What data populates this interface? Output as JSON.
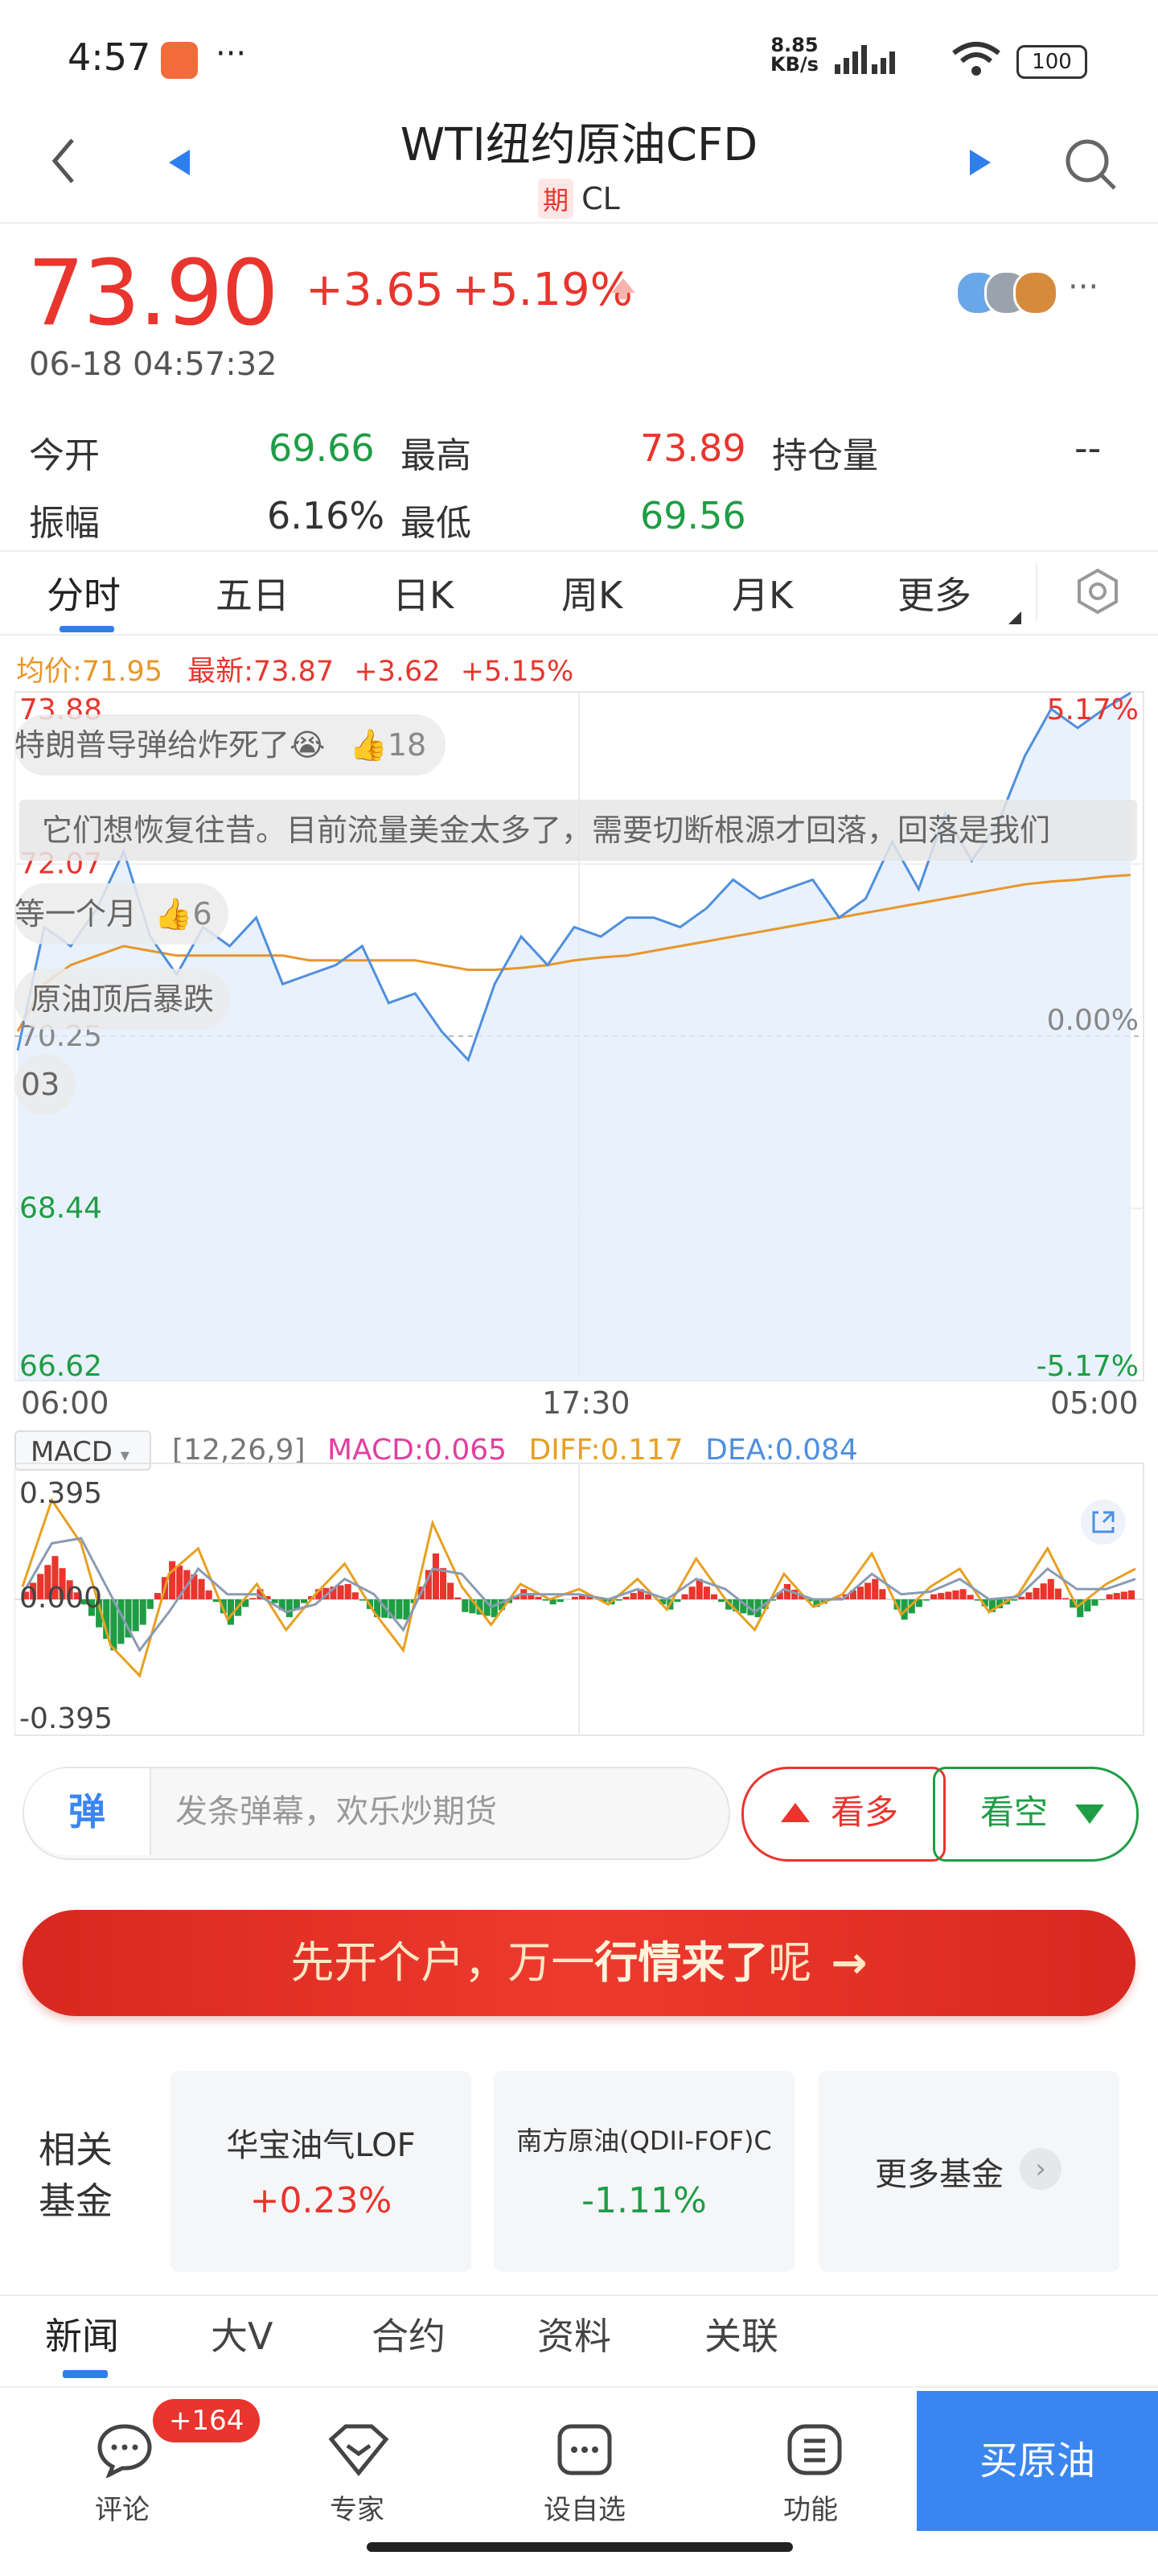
{
  "status_bar": {
    "time": "4:57",
    "dots": "···",
    "net_speed_line1": "8.85",
    "net_speed_line2": "KB/s",
    "battery": "100"
  },
  "header": {
    "title": "WTI纽约原油CFD",
    "tag": "期",
    "symbol": "CL"
  },
  "quote": {
    "price": "73.90",
    "change": "+3.65",
    "change_pct": "+5.19%",
    "datetime": "06-18 04:57:32",
    "more_dots": "···"
  },
  "stats": {
    "open_label": "今开",
    "open_value": "69.66",
    "high_label": "最高",
    "high_value": "73.89",
    "oi_label": "持仓量",
    "oi_value": "--",
    "amp_label": "振幅",
    "amp_value": "6.16%",
    "low_label": "最低",
    "low_value": "69.56"
  },
  "tabs": [
    "分时",
    "五日",
    "日K",
    "周K",
    "月K",
    "更多"
  ],
  "intraday": {
    "avg_label": "均价:71.95",
    "latest_label": "最新:73.87",
    "latest_change": "+3.62",
    "latest_pct": "+5.15%",
    "y_left": [
      "73.88",
      "72.07",
      "70.25",
      "68.44",
      "66.62"
    ],
    "y_right": [
      "5.17%",
      "0.00%",
      "-5.17%"
    ],
    "x_labels": [
      "06:00",
      "17:30",
      "05:00"
    ]
  },
  "danmaku": [
    {
      "text": "特朗普导弹给炸死了😭",
      "likes": "18"
    },
    {
      "text": "它们想恢复往昔。目前流量美金太多了，需要切断根源才回落，回落是我们"
    },
    {
      "text": "等一个月",
      "likes": "6"
    },
    {
      "text": "原油顶后暴跌"
    },
    {
      "text": "03"
    }
  ],
  "macd": {
    "selector": "MACD",
    "params": "[12,26,9]",
    "macd": "MACD:0.065",
    "diff": "DIFF:0.117",
    "dea": "DEA:0.084",
    "y_labels": [
      "0.395",
      "0.000",
      "-0.395"
    ]
  },
  "chart_data": {
    "type": "line",
    "title": "",
    "x_labels": [
      "06:00",
      "17:30",
      "05:00"
    ],
    "ylim": [
      66.62,
      73.88
    ],
    "prev_close": 70.25,
    "series": [
      {
        "name": "最新",
        "values": [
          70.1,
          71.4,
          71.2,
          71.6,
          72.2,
          71.3,
          70.9,
          71.4,
          71.2,
          71.5,
          70.8,
          70.9,
          71.0,
          71.2,
          70.6,
          70.7,
          70.3,
          70.0,
          70.8,
          71.3,
          71.0,
          71.4,
          71.3,
          71.5,
          71.5,
          71.4,
          71.6,
          71.9,
          71.7,
          71.8,
          71.9,
          71.5,
          71.7,
          72.3,
          71.8,
          72.6,
          72.1,
          72.5,
          73.2,
          73.7,
          73.5,
          73.7,
          73.87
        ]
      },
      {
        "name": "均价",
        "values": [
          70.3,
          70.8,
          71.0,
          71.1,
          71.2,
          71.15,
          71.1,
          71.1,
          71.1,
          71.1,
          71.1,
          71.05,
          71.05,
          71.05,
          71.05,
          71.05,
          71.0,
          70.95,
          70.95,
          70.97,
          71.0,
          71.05,
          71.08,
          71.1,
          71.15,
          71.2,
          71.25,
          71.3,
          71.35,
          71.4,
          71.45,
          71.5,
          71.55,
          71.6,
          71.65,
          71.7,
          71.75,
          71.8,
          71.85,
          71.88,
          71.9,
          71.93,
          71.95
        ]
      }
    ]
  },
  "macd_data": {
    "diff": [
      0.05,
      0.39,
      0.22,
      -0.18,
      -0.3,
      0.1,
      0.2,
      -0.08,
      0.06,
      -0.12,
      0.02,
      0.14,
      -0.05,
      -0.2,
      0.3,
      0.05,
      -0.1,
      0.06,
      0.0,
      0.04,
      -0.02,
      0.08,
      -0.04,
      0.16,
      0.0,
      -0.12,
      0.1,
      -0.03,
      0.02,
      0.18,
      -0.06,
      0.05,
      0.12,
      -0.05,
      0.02,
      0.2,
      -0.03,
      0.06,
      0.12
    ],
    "dea": [
      0.02,
      0.22,
      0.24,
      0.02,
      -0.2,
      -0.05,
      0.12,
      0.02,
      0.02,
      -0.05,
      -0.02,
      0.08,
      0.02,
      -0.12,
      0.12,
      0.1,
      -0.03,
      0.02,
      0.02,
      0.02,
      0.0,
      0.04,
      0.0,
      0.08,
      0.04,
      -0.05,
      0.04,
      0.0,
      0.0,
      0.1,
      0.02,
      0.03,
      0.08,
      0.0,
      0.01,
      0.12,
      0.04,
      0.04,
      0.08
    ]
  },
  "actions": {
    "danmu_icon": "弹",
    "danmu_placeholder": "发条弹幕，欢乐炒期货",
    "long_label": "看多",
    "short_label": "看空"
  },
  "banner": {
    "text_part1": "先开个户，万一",
    "text_bold": "行情来了",
    "text_part2": "呢",
    "arrow": "→"
  },
  "related_funds": {
    "title_line1": "相关",
    "title_line2": "基金",
    "items": [
      {
        "name": "华宝油气LOF",
        "change": "+0.23%"
      },
      {
        "name": "南方原油(QDII-FOF)C",
        "change": "-1.11%"
      }
    ],
    "more_label": "更多基金"
  },
  "bottom_tabs": [
    "新闻",
    "大V",
    "合约",
    "资料",
    "关联"
  ],
  "nav": {
    "comment_label": "评论",
    "comment_badge": "+164",
    "expert_label": "专家",
    "watch_label": "设自选",
    "func_label": "功能",
    "buy_label": "买原油"
  },
  "colors": {
    "up": "#e8352d",
    "down": "#1f9d45",
    "accent": "#2f7ef0",
    "line": "#4f8fde",
    "avg": "#e8962a"
  }
}
